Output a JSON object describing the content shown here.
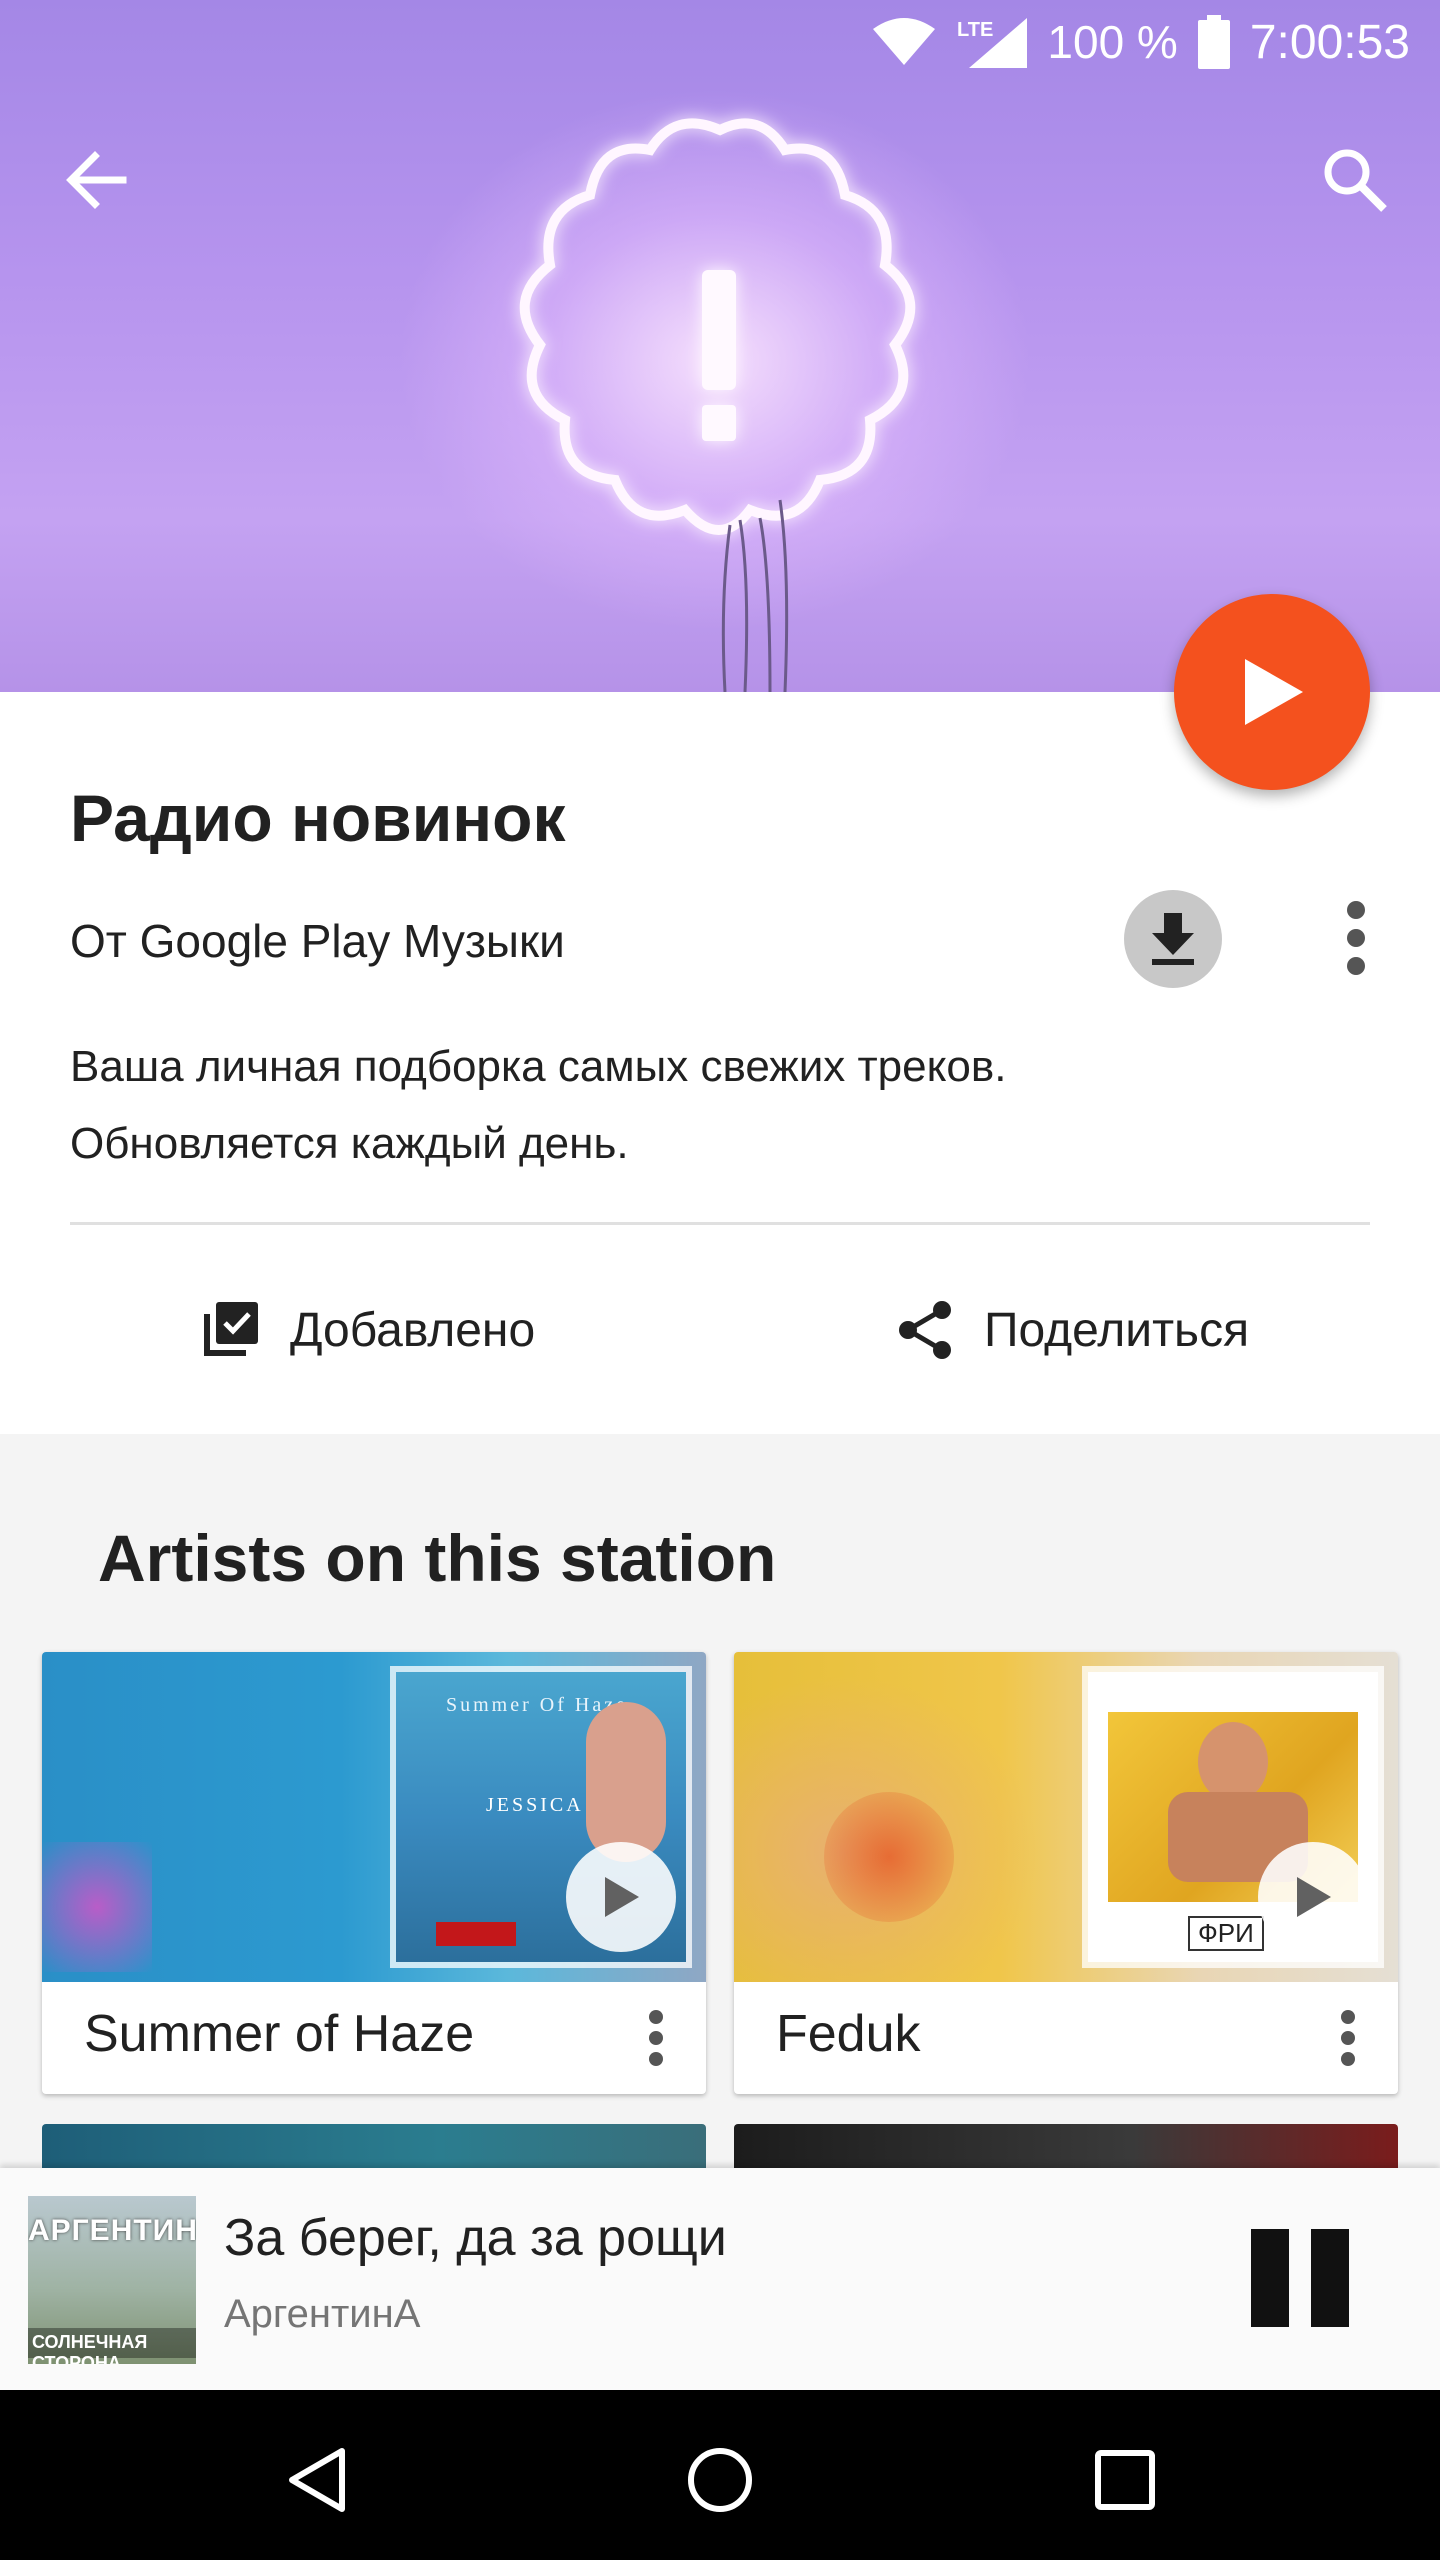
{
  "status_bar": {
    "network": "LTE",
    "battery": "100 %",
    "time": "7:00:53"
  },
  "header": {
    "back_icon": "arrow-left-icon",
    "search_icon": "search-icon"
  },
  "station": {
    "title": "Радио новинок",
    "byline": "От Google Play Музыки",
    "description_line1": "Ваша личная подборка самых свежих треков.",
    "description_line2": "Обновляется каждый день.",
    "added_label": "Добавлено",
    "share_label": "Поделиться"
  },
  "artists_section": {
    "title": "Artists on this station",
    "artists": [
      {
        "name": "Summer of Haze",
        "cover_text_top": "Summer Of Haze",
        "cover_text_mid": "JESSICA"
      },
      {
        "name": "Feduk",
        "cover_text_bottom": "ФРИ"
      }
    ]
  },
  "now_playing": {
    "title": "За берег, да за рощи",
    "artist": "АргентинА",
    "cover_text_top": "АРГЕНТИНА",
    "cover_text_bottom": "СОЛНЕЧНАЯ СТОРОНА"
  },
  "colors": {
    "accent": "#f4511e",
    "hero_purple": "#b694ee"
  }
}
